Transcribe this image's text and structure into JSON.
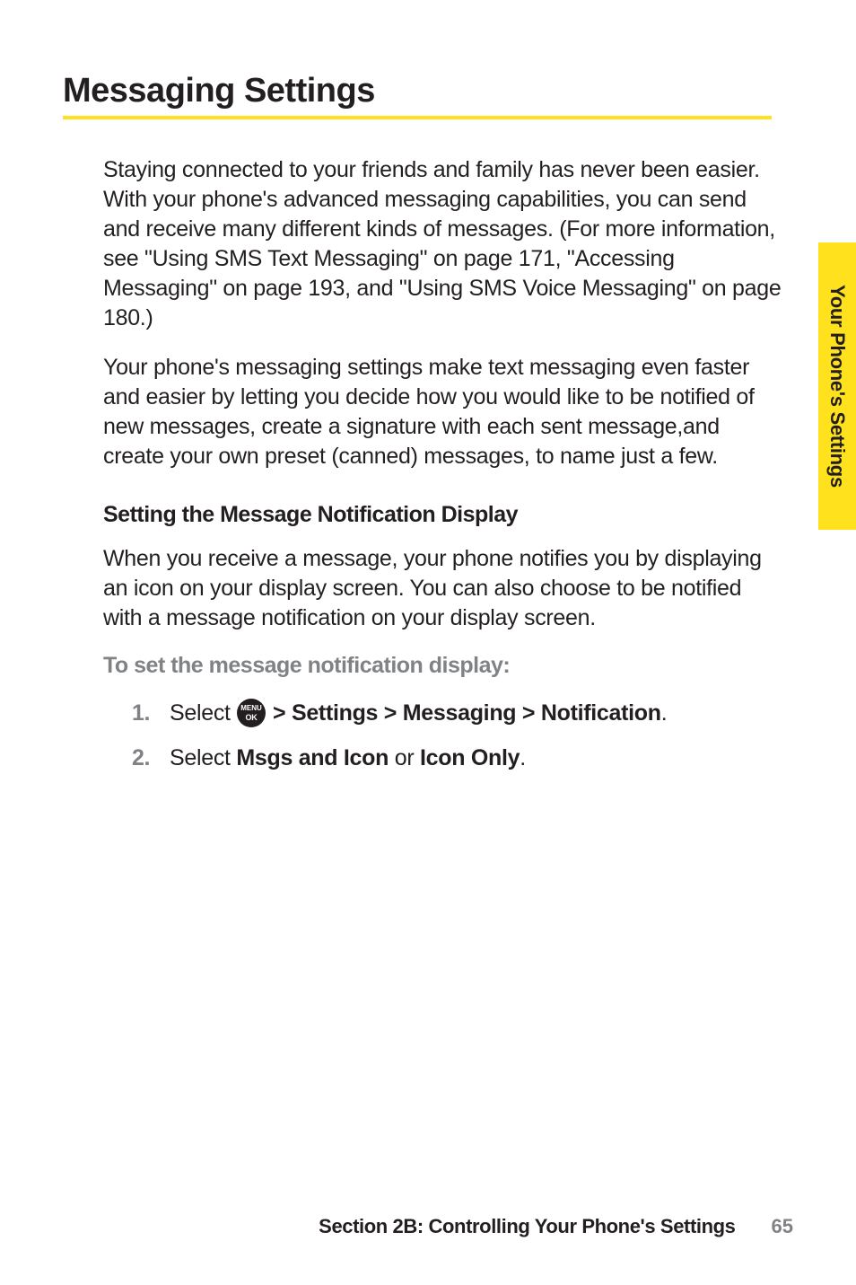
{
  "heading": "Messaging Settings",
  "para1": "Staying connected to your friends and family has never been easier. With your phone's advanced messaging capabilities, you can send and receive many different kinds of messages. (For more information, see \"Using SMS Text Messaging\" on page 171, \"Accessing Messaging\" on page 193, and \"Using SMS Voice Messaging\" on page 180.)",
  "para2": "Your phone's messaging settings make text messaging even faster and easier by letting you decide how you would like to be notified of new messages, create a signature with each sent message,and create your own preset (canned) messages, to name just a few.",
  "subheading": "Setting the Message Notification Display",
  "para3": "When you receive a message, your phone notifies you by displaying an icon on your display screen. You can also choose to be notified with a message notification on your display screen.",
  "instruction": "To set the message notification display:",
  "list": {
    "item1": {
      "num": "1.",
      "pre": "Select ",
      "post": "> Settings > Messaging > Notification",
      "end": "."
    },
    "item2": {
      "num": "2.",
      "pre": "Select ",
      "b1": "Msgs and Icon",
      "mid": " or ",
      "b2": "Icon Only",
      "end": "."
    }
  },
  "sidetab": "Your Phone's Settings",
  "footer": {
    "section": "Section 2B: Controlling Your Phone's Settings",
    "page": "65"
  },
  "icon": {
    "top": "MENU",
    "bottom": "OK"
  }
}
